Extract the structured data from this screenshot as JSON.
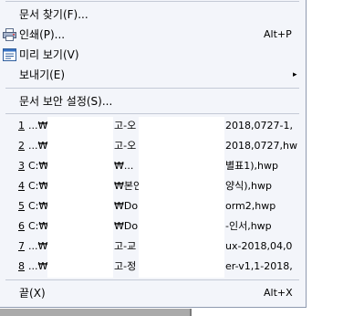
{
  "menu": {
    "find_doc": "문서 찾기(F)...",
    "print": {
      "label": "인쇄(P)...",
      "shortcut": "Alt+P"
    },
    "preview": "미리 보기(V)",
    "send": "보내기(E)",
    "send_arrow": "▸",
    "security": "문서 보안 설정(S)...",
    "exit": {
      "label": "끝(X)",
      "shortcut": "Alt+X"
    }
  },
  "recent_files": [
    {
      "num": "1",
      "prefix": " ...₩",
      "mid": "고-오",
      "tail": "2018,0727-1,"
    },
    {
      "num": "2",
      "prefix": " ...₩",
      "mid": "고-오",
      "tail": "2018,0727,hw"
    },
    {
      "num": "3",
      "prefix": " C:₩",
      "mid": "₩...",
      "tail": "별표1),hwp"
    },
    {
      "num": "4",
      "prefix": " C:₩",
      "mid": "₩본인",
      "tail": "양식),hwp"
    },
    {
      "num": "5",
      "prefix": " C:₩",
      "mid": "₩Do",
      "tail": "orm2,hwp"
    },
    {
      "num": "6",
      "prefix": " C:₩",
      "mid": "₩Do",
      "tail": "-인서,hwp"
    },
    {
      "num": "7",
      "prefix": " ...₩",
      "mid": "고-교",
      "tail": "ux-2018,04,0"
    },
    {
      "num": "8",
      "prefix": " ...₩",
      "mid": "고-정",
      "tail": "er-v1,1-2018,"
    }
  ],
  "icons": {
    "print": "printer-icon",
    "preview": "preview-window-icon"
  },
  "colors": {
    "menu_bg": "#f3f5fa",
    "separator": "#c4cad6",
    "border": "#8f9ab0"
  }
}
